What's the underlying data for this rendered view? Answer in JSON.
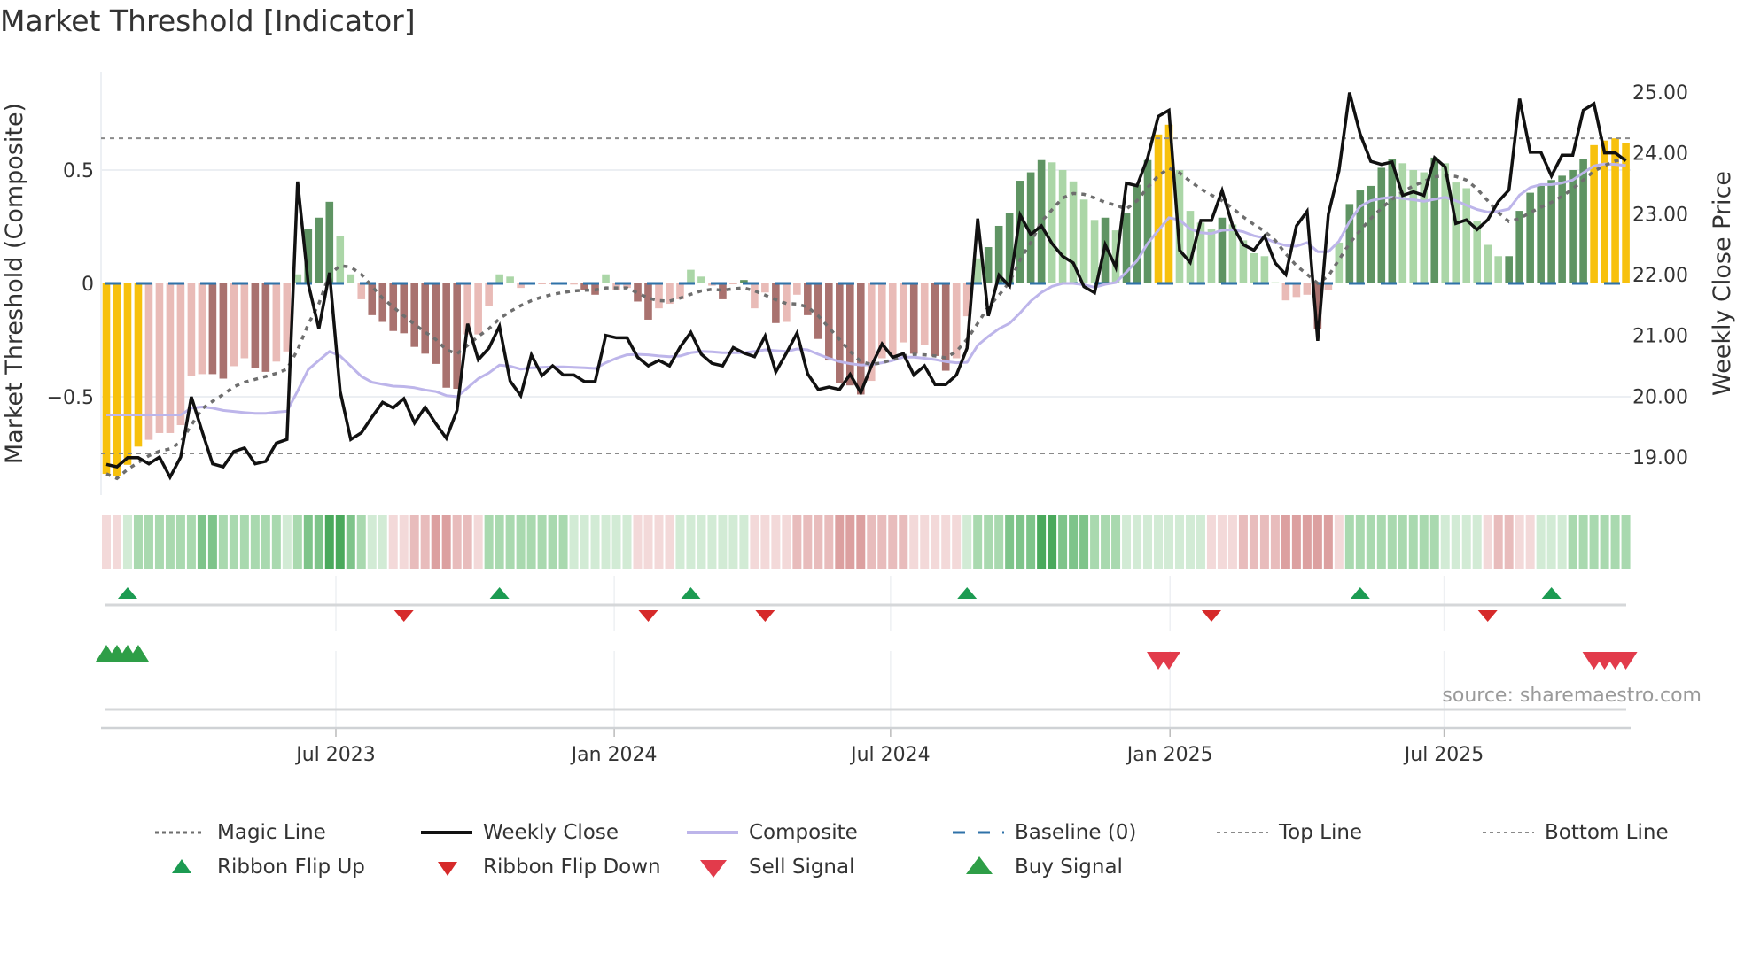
{
  "title": "Market Threshold [Indicator]",
  "source": "source: sharemaestro.com",
  "colors": {
    "bar": {
      "y": "#F7C10D",
      "dg": "#5F9463",
      "lg": "#ABD6A7",
      "dr": "#A9726F",
      "lp": "#E9BBB7"
    },
    "ribbon": {
      "-3": "#DCA0A0",
      "-2": "#E8BCBC",
      "-1": "#F3D9D9",
      "1": "#D2EBD5",
      "2": "#A9D9AF",
      "3": "#7EC48A",
      "4": "#4AA95C"
    },
    "weekly_close": "#111111",
    "composite": "#BDB5EA",
    "magic": "#6E6E6E",
    "baseline": "#2F72A8",
    "threshold_lines": "#8A8A8A",
    "flip_up": "#1C9B52",
    "flip_down": "#D62A2A",
    "buy": "#2E9E47",
    "sell": "#E23B4B"
  },
  "chart_data": {
    "type": "bar+line",
    "title": "Market Threshold [Indicator]",
    "ylabel_left": "Market Threshold (Composite)",
    "ylabel_right": "Weekly Close Price",
    "ylim_left": [
      -0.93,
      0.93
    ],
    "ylim_right": [
      18.38,
      25.33
    ],
    "left_ticks": [
      {
        "v": 0.5,
        "label": "0.5"
      },
      {
        "v": 0,
        "label": "0"
      },
      {
        "v": -0.5,
        "label": "−0.5"
      }
    ],
    "right_ticks": [
      {
        "v": 25,
        "label": "25.00"
      },
      {
        "v": 24,
        "label": "24.00"
      },
      {
        "v": 23,
        "label": "23.00"
      },
      {
        "v": 22,
        "label": "22.00"
      },
      {
        "v": 21,
        "label": "21.00"
      },
      {
        "v": 20,
        "label": "20.00"
      },
      {
        "v": 19,
        "label": "19.00"
      }
    ],
    "x_unit": "week index",
    "x_ticks": [
      {
        "week": 21.6,
        "label": "Jul 2023"
      },
      {
        "week": 47.8,
        "label": "Jan 2024"
      },
      {
        "week": 73.8,
        "label": "Jul 2024"
      },
      {
        "week": 100.1,
        "label": "Jan 2025"
      },
      {
        "week": 125.9,
        "label": "Jul 2025"
      }
    ],
    "top_line": 0.64,
    "bottom_line": -0.75,
    "baseline": 0,
    "composite_bars": [
      -0.84,
      -0.85,
      -0.8,
      -0.72,
      -0.69,
      -0.66,
      -0.66,
      -0.625,
      -0.41,
      -0.4,
      -0.4,
      -0.42,
      -0.365,
      -0.33,
      -0.375,
      -0.39,
      -0.345,
      -0.3,
      0.04,
      0.24,
      0.29,
      0.36,
      0.21,
      0.04,
      -0.07,
      -0.14,
      -0.17,
      -0.21,
      -0.22,
      -0.28,
      -0.31,
      -0.355,
      -0.46,
      -0.465,
      -0.225,
      -0.225,
      -0.1,
      0.04,
      0.03,
      -0.02,
      -0.005,
      -0.004,
      -0.004,
      -0.004,
      -0.005,
      -0.03,
      -0.05,
      0.04,
      -0.03,
      -0.02,
      -0.08,
      -0.16,
      -0.11,
      -0.09,
      -0.07,
      0.06,
      0.03,
      -0.01,
      -0.07,
      -0.004,
      0.015,
      -0.11,
      -0.04,
      -0.175,
      -0.17,
      -0.05,
      -0.14,
      -0.245,
      -0.34,
      -0.44,
      -0.45,
      -0.49,
      -0.43,
      -0.33,
      -0.32,
      -0.26,
      -0.31,
      -0.27,
      -0.32,
      -0.385,
      -0.33,
      -0.145,
      0.11,
      0.16,
      0.254,
      0.31,
      0.453,
      0.49,
      0.544,
      0.534,
      0.5,
      0.45,
      0.37,
      0.28,
      0.29,
      0.234,
      0.31,
      0.435,
      0.544,
      0.657,
      0.7,
      0.5,
      0.32,
      0.268,
      0.24,
      0.29,
      0.26,
      0.19,
      0.133,
      0.12,
      0.005,
      -0.075,
      -0.06,
      -0.05,
      -0.2,
      -0.03,
      0.18,
      0.35,
      0.41,
      0.43,
      0.51,
      0.55,
      0.53,
      0.5,
      0.49,
      0.555,
      0.53,
      0.445,
      0.42,
      0.275,
      0.17,
      0.12,
      0.12,
      0.32,
      0.4,
      0.43,
      0.456,
      0.475,
      0.5,
      0.55,
      0.61,
      0.63,
      0.64,
      0.62
    ],
    "bar_colors": [
      "y",
      "y",
      "y",
      "y",
      "lp",
      "lp",
      "lp",
      "lp",
      "lp",
      "lp",
      "dr",
      "dr",
      "lp",
      "lp",
      "dr",
      "dr",
      "lp",
      "lp",
      "lg",
      "dg",
      "dg",
      "dg",
      "lg",
      "lg",
      "lp",
      "dr",
      "dr",
      "dr",
      "dr",
      "dr",
      "dr",
      "dr",
      "dr",
      "dr",
      "lp",
      "lp",
      "lp",
      "lg",
      "lg",
      "lp",
      "lp",
      "lp",
      "lp",
      "lp",
      "lp",
      "dr",
      "dr",
      "lg",
      "lp",
      "lp",
      "dr",
      "dr",
      "lp",
      "lp",
      "lp",
      "lg",
      "lg",
      "lp",
      "dr",
      "lp",
      "dg",
      "lp",
      "lp",
      "dr",
      "lp",
      "lp",
      "dr",
      "dr",
      "dr",
      "dr",
      "dr",
      "dr",
      "lp",
      "lp",
      "lp",
      "lp",
      "dr",
      "lp",
      "dr",
      "dr",
      "lp",
      "lp",
      "lg",
      "dg",
      "dg",
      "dg",
      "dg",
      "dg",
      "dg",
      "lg",
      "lg",
      "lg",
      "lg",
      "lg",
      "dg",
      "lg",
      "dg",
      "dg",
      "dg",
      "y",
      "y",
      "lg",
      "lg",
      "lg",
      "lg",
      "dg",
      "lg",
      "lg",
      "lg",
      "lg",
      "lg",
      "lp",
      "lp",
      "lp",
      "dr",
      "lp",
      "lg",
      "dg",
      "dg",
      "dg",
      "dg",
      "dg",
      "lg",
      "lg",
      "lg",
      "dg",
      "lg",
      "lg",
      "lg",
      "lg",
      "lg",
      "lg",
      "dg",
      "dg",
      "dg",
      "dg",
      "dg",
      "dg",
      "dg",
      "dg",
      "y",
      "y",
      "y",
      "y"
    ],
    "weekly_close": [
      18.88,
      18.84,
      18.99,
      18.99,
      18.89,
      19.0,
      18.67,
      19.0,
      19.99,
      19.43,
      18.89,
      18.84,
      19.09,
      19.15,
      18.89,
      18.93,
      19.23,
      19.29,
      23.53,
      21.85,
      21.11,
      22.03,
      20.08,
      19.29,
      19.4,
      19.66,
      19.9,
      19.81,
      19.96,
      19.56,
      19.82,
      19.55,
      19.31,
      19.77,
      21.19,
      20.6,
      20.79,
      21.15,
      20.25,
      20.01,
      20.68,
      20.34,
      20.5,
      20.35,
      20.35,
      20.24,
      20.24,
      21.0,
      20.96,
      20.96,
      20.64,
      20.5,
      20.59,
      20.5,
      20.81,
      21.05,
      20.69,
      20.54,
      20.5,
      20.8,
      20.71,
      20.65,
      20.99,
      20.4,
      20.71,
      21.04,
      20.37,
      20.11,
      20.15,
      20.11,
      20.36,
      20.06,
      20.5,
      20.86,
      20.64,
      20.7,
      20.35,
      20.5,
      20.19,
      20.19,
      20.35,
      20.79,
      22.92,
      21.32,
      21.99,
      21.81,
      22.98,
      22.66,
      22.8,
      22.51,
      22.3,
      22.19,
      21.8,
      21.7,
      22.49,
      22.12,
      23.5,
      23.46,
      23.92,
      24.6,
      24.7,
      22.4,
      22.2,
      22.89,
      22.89,
      23.38,
      22.8,
      22.49,
      22.4,
      22.63,
      22.19,
      22.0,
      22.8,
      23.04,
      20.91,
      22.99,
      23.7,
      24.99,
      24.31,
      23.86,
      23.81,
      23.85,
      23.3,
      23.36,
      23.3,
      23.92,
      23.77,
      22.84,
      22.9,
      22.74,
      22.9,
      23.2,
      23.39,
      24.89,
      24.01,
      24.01,
      23.62,
      23.96,
      23.96,
      24.7,
      24.81,
      24.0,
      24.0,
      23.87
    ],
    "composite_line": [
      -0.58,
      -0.58,
      -0.58,
      -0.58,
      -0.58,
      -0.58,
      -0.58,
      -0.58,
      -0.55,
      -0.545,
      -0.55,
      -0.56,
      -0.565,
      -0.57,
      -0.573,
      -0.573,
      -0.568,
      -0.564,
      -0.475,
      -0.38,
      -0.34,
      -0.3,
      -0.32,
      -0.365,
      -0.41,
      -0.436,
      -0.445,
      -0.453,
      -0.455,
      -0.46,
      -0.47,
      -0.477,
      -0.495,
      -0.5,
      -0.46,
      -0.42,
      -0.395,
      -0.36,
      -0.365,
      -0.378,
      -0.372,
      -0.37,
      -0.368,
      -0.368,
      -0.37,
      -0.372,
      -0.375,
      -0.35,
      -0.33,
      -0.315,
      -0.313,
      -0.315,
      -0.32,
      -0.323,
      -0.32,
      -0.306,
      -0.3,
      -0.302,
      -0.306,
      -0.306,
      -0.306,
      -0.3,
      -0.293,
      -0.297,
      -0.3,
      -0.289,
      -0.293,
      -0.3125,
      -0.33,
      -0.345,
      -0.354,
      -0.36,
      -0.358,
      -0.35,
      -0.34,
      -0.325,
      -0.325,
      -0.33,
      -0.336,
      -0.345,
      -0.35,
      -0.348,
      -0.273,
      -0.234,
      -0.2,
      -0.176,
      -0.13,
      -0.078,
      -0.04,
      -0.013,
      0.0,
      0.0,
      -0.006,
      -0.017,
      -0.004,
      0.004,
      0.05,
      0.1,
      0.176,
      0.234,
      0.29,
      0.28,
      0.24,
      0.224,
      0.22,
      0.234,
      0.237,
      0.228,
      0.21,
      0.2,
      0.18,
      0.167,
      0.164,
      0.18,
      0.14,
      0.14,
      0.185,
      0.273,
      0.34,
      0.365,
      0.375,
      0.38,
      0.375,
      0.369,
      0.362,
      0.371,
      0.38,
      0.365,
      0.345,
      0.326,
      0.315,
      0.318,
      0.328,
      0.39,
      0.423,
      0.436,
      0.436,
      0.443,
      0.456,
      0.488,
      0.518,
      0.527,
      0.525,
      0.52
    ],
    "magic_line": [
      -0.84,
      -0.86,
      -0.82,
      -0.79,
      -0.76,
      -0.74,
      -0.73,
      -0.7,
      -0.625,
      -0.553,
      -0.52,
      -0.49,
      -0.456,
      -0.436,
      -0.423,
      -0.41,
      -0.397,
      -0.378,
      -0.293,
      -0.18,
      -0.09,
      0.04,
      0.078,
      0.072,
      0.04,
      -0.013,
      -0.065,
      -0.104,
      -0.143,
      -0.18,
      -0.215,
      -0.247,
      -0.293,
      -0.31,
      -0.273,
      -0.234,
      -0.2,
      -0.156,
      -0.124,
      -0.098,
      -0.076,
      -0.06,
      -0.048,
      -0.04,
      -0.033,
      -0.03,
      -0.029,
      -0.02,
      -0.02,
      -0.02,
      -0.042,
      -0.065,
      -0.076,
      -0.078,
      -0.065,
      -0.048,
      -0.033,
      -0.026,
      -0.03,
      -0.024,
      -0.02,
      -0.033,
      -0.052,
      -0.072,
      -0.089,
      -0.091,
      -0.104,
      -0.143,
      -0.195,
      -0.247,
      -0.3,
      -0.345,
      -0.358,
      -0.35,
      -0.336,
      -0.32,
      -0.3125,
      -0.315,
      -0.32,
      -0.328,
      -0.3,
      -0.247,
      -0.176,
      -0.104,
      -0.052,
      0.006,
      0.104,
      0.18,
      0.273,
      0.325,
      0.377,
      0.397,
      0.393,
      0.377,
      0.358,
      0.345,
      0.328,
      0.365,
      0.423,
      0.475,
      0.508,
      0.488,
      0.45,
      0.417,
      0.39,
      0.365,
      0.332,
      0.293,
      0.26,
      0.23,
      0.19,
      0.13,
      0.078,
      0.04,
      0.0,
      0.033,
      0.104,
      0.176,
      0.234,
      0.286,
      0.332,
      0.371,
      0.404,
      0.43,
      0.45,
      0.47,
      0.476,
      0.472,
      0.456,
      0.417,
      0.365,
      0.3125,
      0.273,
      0.286,
      0.3125,
      0.336,
      0.358,
      0.384,
      0.417,
      0.456,
      0.495,
      0.52,
      0.54,
      0.55
    ],
    "ribbon": [
      -1,
      -1,
      1,
      2,
      2,
      2,
      2,
      2,
      2,
      3,
      3,
      2,
      2,
      2,
      2,
      2,
      2,
      1,
      2,
      3,
      3,
      4,
      4,
      3,
      2,
      1,
      1,
      -1,
      -1,
      -2,
      -2,
      -3,
      -3,
      -2,
      -2,
      -1,
      2,
      2,
      2,
      2,
      2,
      2,
      2,
      2,
      1,
      1,
      1,
      1,
      1,
      1,
      -1,
      -1,
      -1,
      -1,
      1,
      1,
      1,
      1,
      1,
      1,
      1,
      -1,
      -1,
      -1,
      -1,
      -2,
      -2,
      -2,
      -2,
      -3,
      -3,
      -3,
      -2,
      -2,
      -2,
      -2,
      -1,
      -1,
      -1,
      -1,
      -1,
      1,
      2,
      2,
      2,
      3,
      3,
      3,
      4,
      4,
      3,
      3,
      3,
      2,
      2,
      2,
      1,
      1,
      1,
      1,
      1,
      1,
      1,
      1,
      -1,
      -1,
      -1,
      -2,
      -2,
      -2,
      -2,
      -3,
      -3,
      -3,
      -3,
      -3,
      -1,
      2,
      2,
      2,
      2,
      2,
      2,
      2,
      2,
      2,
      1,
      1,
      1,
      1,
      -1,
      -2,
      -2,
      -1,
      -1,
      1,
      1,
      1,
      2,
      2,
      2,
      2,
      2,
      2
    ],
    "ribbon_flip_up_weeks": [
      2,
      37,
      55,
      81,
      118,
      136
    ],
    "ribbon_flip_down_weeks": [
      28,
      51,
      62,
      104,
      130
    ],
    "buy_signal_weeks": [
      0,
      1,
      2,
      3
    ],
    "sell_signal_weeks": [
      99,
      100,
      140,
      141,
      142,
      143
    ],
    "legend_position": "bottom"
  },
  "legend": [
    {
      "key": "magic",
      "label": "Magic Line"
    },
    {
      "key": "close",
      "label": "Weekly Close"
    },
    {
      "key": "composite",
      "label": "Composite"
    },
    {
      "key": "baseline",
      "label": "Baseline (0)"
    },
    {
      "key": "top",
      "label": "Top Line"
    },
    {
      "key": "bottom",
      "label": "Bottom Line"
    },
    {
      "key": "flip_up",
      "label": "Ribbon Flip Up"
    },
    {
      "key": "flip_down",
      "label": "Ribbon Flip Down"
    },
    {
      "key": "sell",
      "label": "Sell Signal"
    },
    {
      "key": "buy",
      "label": "Buy Signal"
    }
  ]
}
